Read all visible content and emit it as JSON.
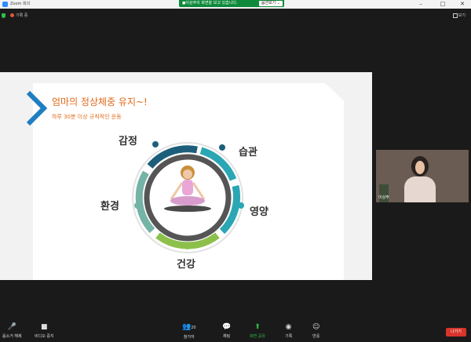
{
  "window": {
    "title": "Zoom 회의",
    "minimize": "–",
    "maximize": "□",
    "close": "✕"
  },
  "share_banner": {
    "text": "●이상주의 화면을 보고 있습니다.",
    "button": "옵션보기 ⌄"
  },
  "recording": {
    "label": "기록 중"
  },
  "view_button": {
    "label": "보기"
  },
  "slide": {
    "title": "엄마의 정상체중 유지~!",
    "subtitle": "하루 30분 이상 규칙적인 운동",
    "labels": {
      "emotion": "감정",
      "habit": "습관",
      "nutrition": "영양",
      "environment": "환경",
      "health": "건강"
    },
    "colors": {
      "accent": "#e06a1a",
      "navy": "#1d5f7a",
      "teal": "#2aa6b4",
      "green": "#8cc04b",
      "sage": "#74b3a6",
      "chevron": "#1f7ec1"
    }
  },
  "participant": {
    "name": "이상주"
  },
  "toolbar": {
    "mute": "음소거 해제",
    "video": "비디오 중지",
    "participants": "참가자",
    "participants_count": "20",
    "chat": "채팅",
    "share": "화면 공유",
    "record": "기록",
    "reactions": "반응",
    "leave": "나가기"
  }
}
